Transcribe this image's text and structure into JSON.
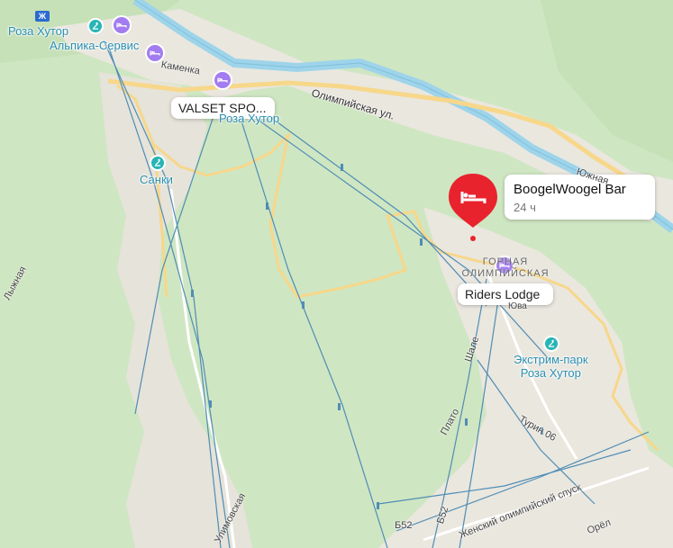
{
  "map": {
    "colors": {
      "forest": "#cfe6c2",
      "town": "#eae7df",
      "road": "#f7d78a",
      "river": "#9ed4ea",
      "lift": "#4f8db5"
    },
    "selected_place": {
      "name": "BoogelWoogel Bar",
      "hours": "24 ч",
      "icon": "hotel-bed-icon",
      "color": "#e8232d"
    },
    "places": [
      {
        "name": "Роза Хутор",
        "kind": "metro-station"
      },
      {
        "name": "Альпика-Сервис",
        "kind": "ski-lift"
      },
      {
        "name": "Санки",
        "kind": "ski-lift"
      },
      {
        "name": "Экстрим-парк\nРоза Хутор",
        "kind": "ski-lift"
      },
      {
        "name": "VALSET SPO...",
        "kind": "hotel-card"
      },
      {
        "name": "Роза Хутор",
        "kind": "ski-lift"
      },
      {
        "name": "Riders Lodge",
        "kind": "hotel-card"
      },
      {
        "name": "Горная Олимпийская",
        "kind": "district"
      }
    ],
    "streets": [
      "Олимпийская ул.",
      "Каменка",
      "Плато",
      "Шале",
      "Турин 06",
      "Б52",
      "Б52",
      "Женский олимпийский спуск",
      "Юва",
      "Орёл",
      "Улимовская",
      "Южная",
      "Лыжная"
    ]
  }
}
